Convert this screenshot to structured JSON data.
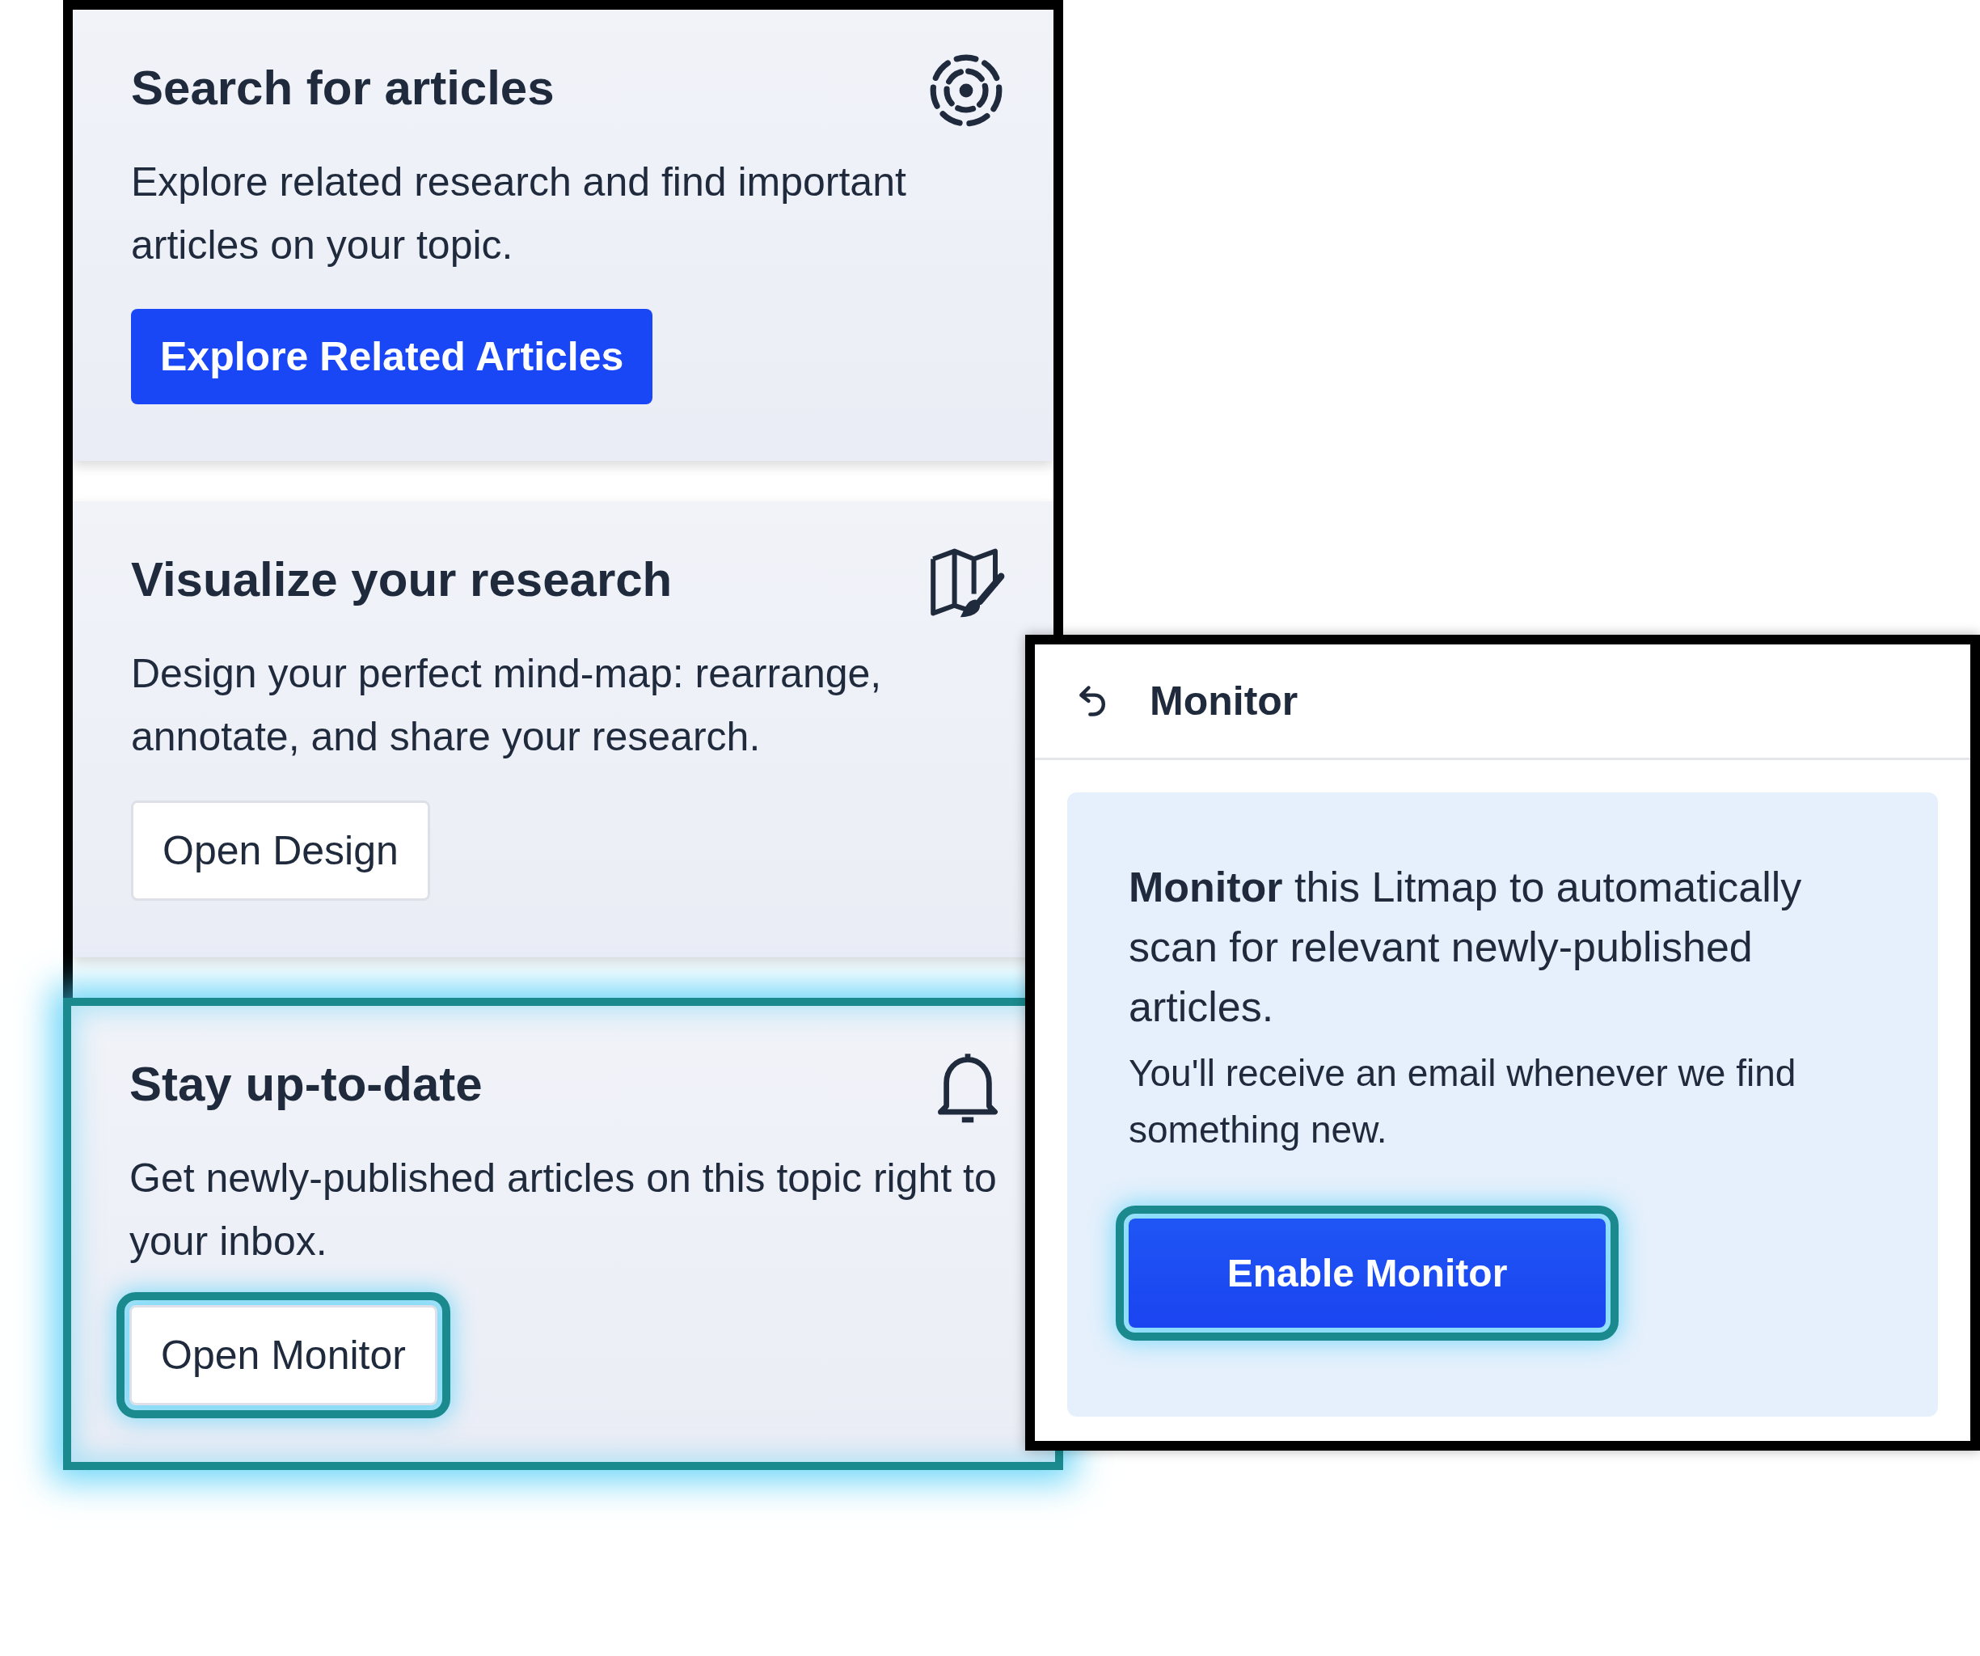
{
  "cards": [
    {
      "title": "Search for articles",
      "description": "Explore related research and find important articles on your topic.",
      "highlighted": false,
      "button": {
        "label": "Explore Related Articles",
        "kind": "primary",
        "highlighted": false
      }
    },
    {
      "title": "Visualize your research",
      "description": "Design your perfect mind-map: rearrange, annotate, and share your research.",
      "highlighted": false,
      "button": {
        "label": "Open Design",
        "kind": "secondary",
        "highlighted": false
      }
    },
    {
      "title": "Stay up-to-date",
      "description": "Get newly-published articles on this topic right to your inbox.",
      "highlighted": true,
      "button": {
        "label": "Open Monitor",
        "kind": "secondary",
        "highlighted": true
      }
    }
  ],
  "monitor_panel": {
    "title": "Monitor",
    "intro": "**Monitor** this Litmap to automatically scan for relevant newly-published articles.",
    "note": "You'll receive an email whenever we find something new.",
    "button": {
      "label": "Enable Monitor",
      "kind": "primary",
      "highlighted": true
    }
  }
}
